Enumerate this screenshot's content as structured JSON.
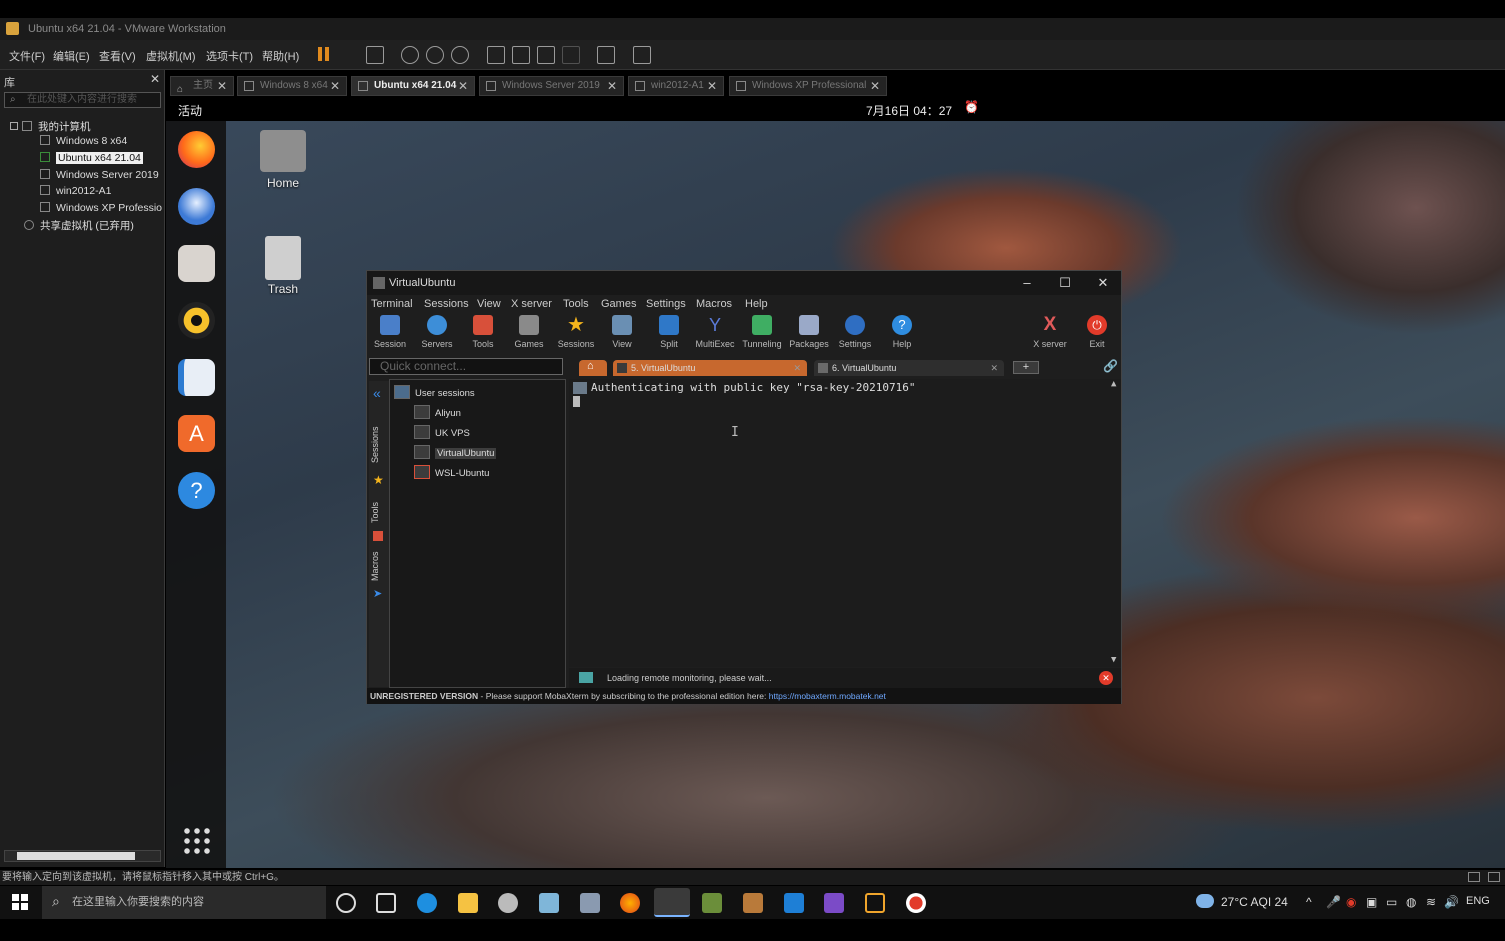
{
  "vm": {
    "window_title": "Ubuntu x64 21.04 - VMware Workstation",
    "menu": [
      "文件(F)",
      "编辑(E)",
      "查看(V)",
      "虚拟机(M)",
      "选项卡(T)",
      "帮助(H)"
    ],
    "tabs": [
      {
        "label": "主页"
      },
      {
        "label": "Windows 8 x64"
      },
      {
        "label": "Ubuntu x64 21.04",
        "active": true
      },
      {
        "label": "Windows Server 2019"
      },
      {
        "label": "win2012-A1"
      },
      {
        "label": "Windows XP Professional"
      }
    ],
    "library": {
      "title": "库",
      "search_placeholder": "在此处键入内容进行搜索",
      "root": "我的计算机",
      "items": [
        "Windows 8 x64",
        "Ubuntu x64 21.04",
        "Windows Server 2019",
        "win2012-A1",
        "Windows XP Professio"
      ],
      "shared": "共享虚拟机 (已弃用)"
    },
    "status_text": "要将输入定向到该虚拟机，请将鼠标指针移入其中或按 Ctrl+G。"
  },
  "ubuntu": {
    "activities": "活动",
    "clock": "7月16日  04：27",
    "desktop_icons": [
      {
        "label": "Home",
        "icon": "home-folder-icon"
      },
      {
        "label": "Trash",
        "icon": "trash-icon"
      }
    ],
    "dock_icons": [
      "firefox-icon",
      "thunderbird-icon",
      "files-icon",
      "rhythmbox-icon",
      "writer-icon",
      "app-center-icon",
      "help-icon",
      "show-apps-icon"
    ]
  },
  "moba": {
    "title": "VirtualUbuntu",
    "menu": [
      "Terminal",
      "Sessions",
      "View",
      "X server",
      "Tools",
      "Games",
      "Settings",
      "Macros",
      "Help"
    ],
    "toolbar": [
      "Session",
      "Servers",
      "Tools",
      "Games",
      "Sessions",
      "View",
      "Split",
      "MultiExec",
      "Tunneling",
      "Packages",
      "Settings",
      "Help"
    ],
    "toolbar_right": [
      "X server",
      "Exit"
    ],
    "quick_connect": "Quick connect...",
    "side_tabs": [
      "Sessions",
      "Tools",
      "Macros"
    ],
    "sessions_root": "User sessions",
    "sessions": [
      "Aliyun",
      "UK VPS",
      "VirtualUbuntu",
      "WSL-Ubuntu"
    ],
    "session_tabs": [
      "5. VirtualUbuntu",
      "6. VirtualUbuntu"
    ],
    "terminal_line": "Authenticating with public key \"rsa-key-20210716\"",
    "status": "Loading remote monitoring, please wait...",
    "footer_label": "UNREGISTERED VERSION",
    "footer_text": " -  Please support MobaXterm by subscribing to the professional edition here: ",
    "footer_link": "https://mobaxterm.mobatek.net"
  },
  "taskbar": {
    "search_placeholder": "在这里输入你要搜索的内容",
    "weather": "27°C  AQI 24",
    "lang": "ENG"
  },
  "colors": {
    "moba_accent": "#d35a2a",
    "tab_orange": "#c7682e",
    "link": "#6fa8ff",
    "exit_red": "#e23b2a"
  }
}
